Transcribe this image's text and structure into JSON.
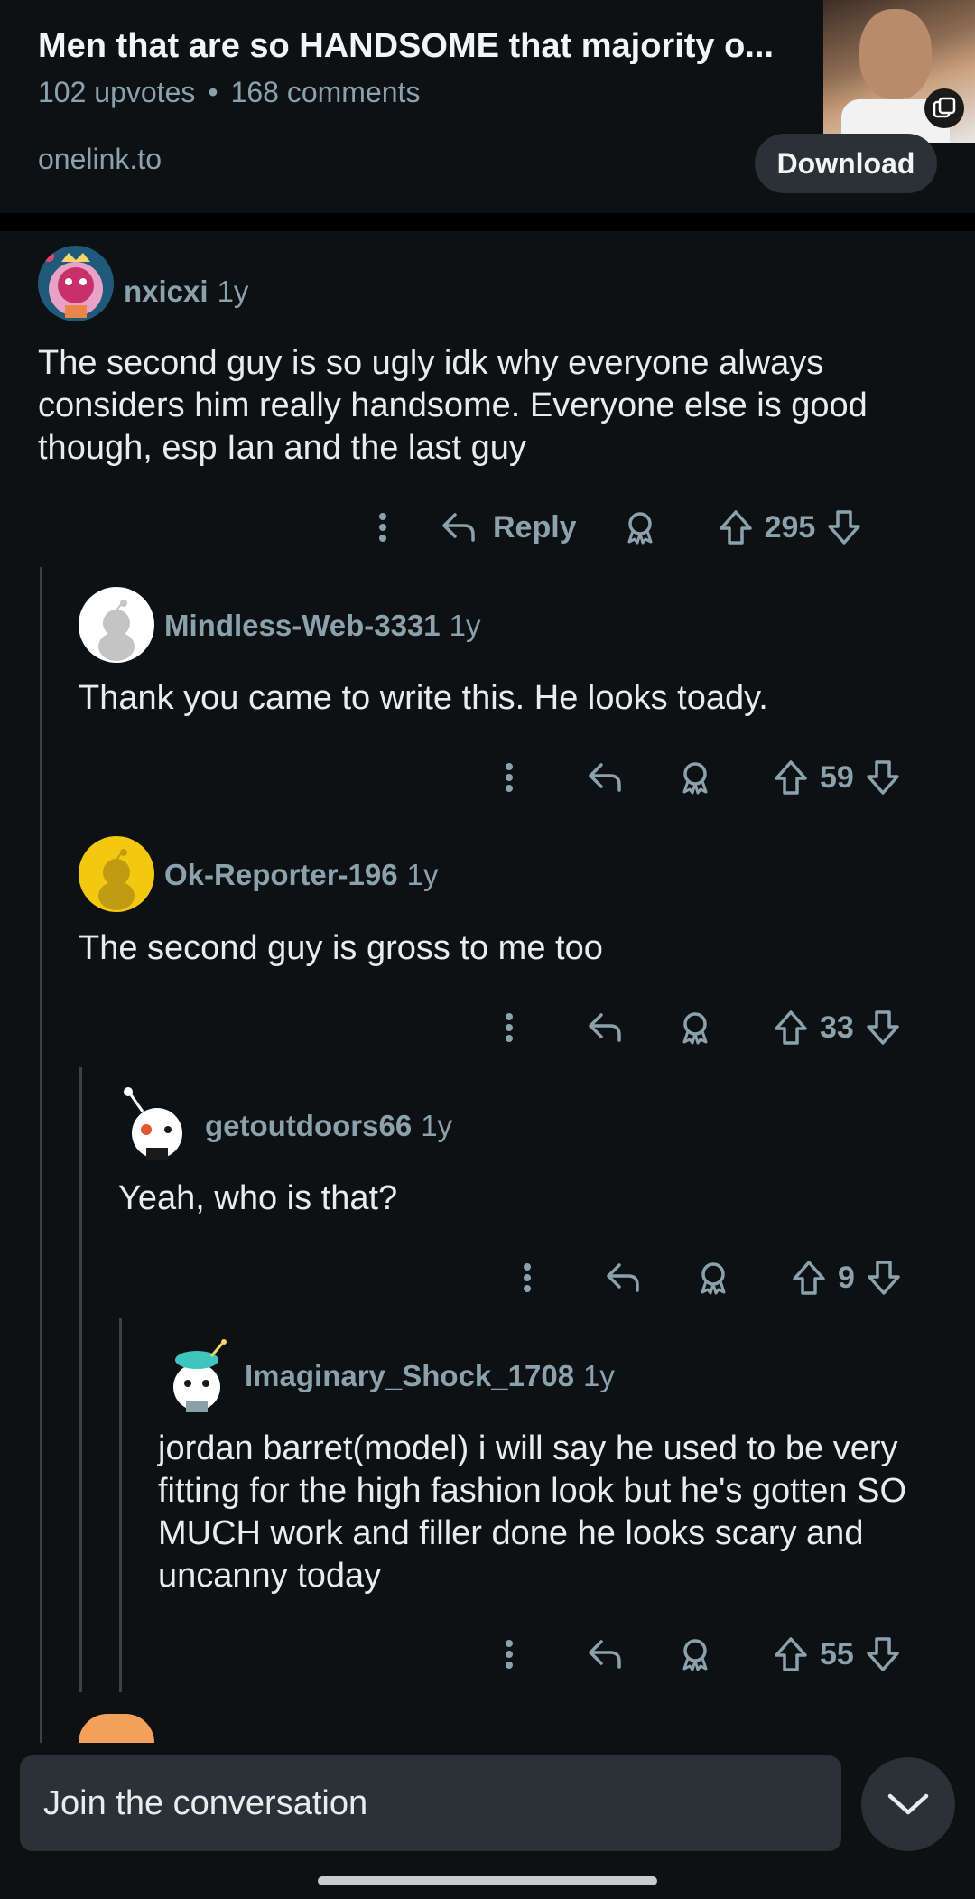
{
  "post": {
    "title": "Men that are so HANDSOME that majority o...",
    "upvotes": "102 upvotes",
    "separator": "•",
    "comments": "168 comments"
  },
  "ad": {
    "domain": "onelink.to",
    "cta": "Download"
  },
  "comments": [
    {
      "user": "nxicxi",
      "age": "1y",
      "text": "The second guy is so ugly idk why everyone always considers him really handsome. Everyone else is good though, esp Ian and the last guy",
      "reply_label": "Reply",
      "score": "295"
    },
    {
      "user": "Mindless-Web-3331",
      "age": "1y",
      "text": "Thank you came to write this. He looks toady.",
      "score": "59"
    },
    {
      "user": "Ok-Reporter-196",
      "age": "1y",
      "text": "The second guy is gross to me too",
      "score": "33"
    },
    {
      "user": "getoutdoors66",
      "age": "1y",
      "text": "Yeah, who is that?",
      "score": "9"
    },
    {
      "user": "Imaginary_Shock_1708",
      "age": "1y",
      "text": "jordan barret(model) i will say he used to be very fitting for the high fashion look but he's gotten SO MUCH work and filler done he looks scary and uncanny today",
      "score": "55"
    }
  ],
  "composer": {
    "placeholder": "Join the conversation"
  },
  "colors": {
    "background": "#0e1113",
    "muted": "#8ba2ad",
    "surface": "#2a3236",
    "text": "#e9ecee"
  }
}
